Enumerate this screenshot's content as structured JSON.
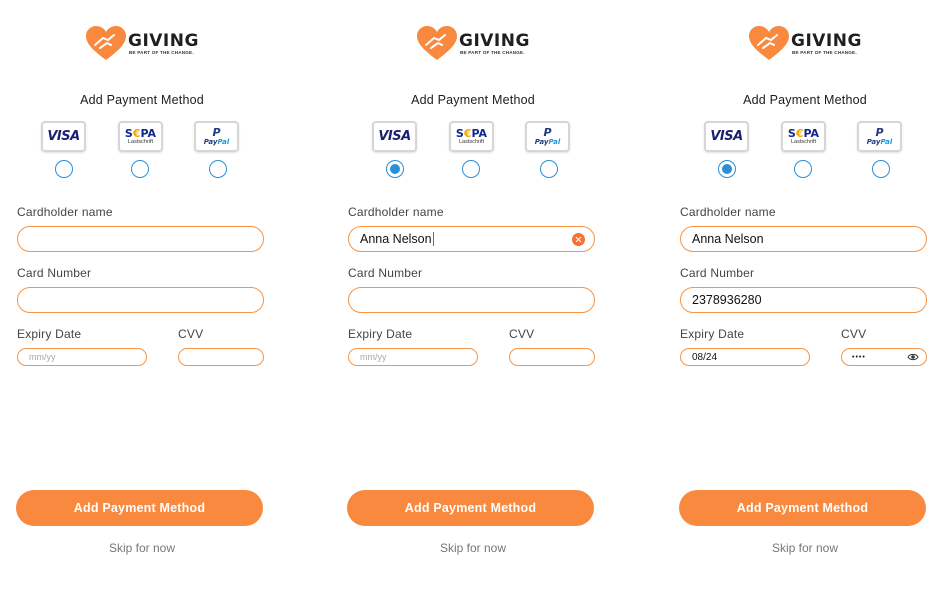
{
  "brand": {
    "name": "GIVING",
    "tagline": "BE PART OF THE CHANGE.",
    "color": "#f8893e"
  },
  "common": {
    "title": "Add Payment Method",
    "methods": [
      {
        "name": "VISA",
        "icon": "visa-logo"
      },
      {
        "name": "SEPA",
        "sub": "Lastschrift",
        "icon": "sepa-logo"
      },
      {
        "name": "PayPal",
        "icon": "paypal-logo"
      }
    ],
    "labels": {
      "cardholder": "Cardholder name",
      "card_number": "Card Number",
      "expiry": "Expiry Date",
      "cvv": "CVV"
    },
    "expiry_placeholder": "mm/yy",
    "submit": "Add Payment Method",
    "skip": "Skip for now"
  },
  "screens": [
    {
      "selected_method": null,
      "cardholder": "",
      "card_number": "",
      "expiry": "",
      "cvv": ""
    },
    {
      "selected_method": "VISA",
      "cardholder": "Anna Nelson",
      "card_number": "",
      "expiry": "",
      "cvv": ""
    },
    {
      "selected_method": "VISA",
      "cardholder": "Anna Nelson",
      "card_number": "2378936280",
      "expiry": "08/24",
      "cvv": "••••"
    }
  ],
  "colors": {
    "accent": "#f8893e",
    "field_border": "#f79445",
    "radio": "#2b8fd8"
  }
}
